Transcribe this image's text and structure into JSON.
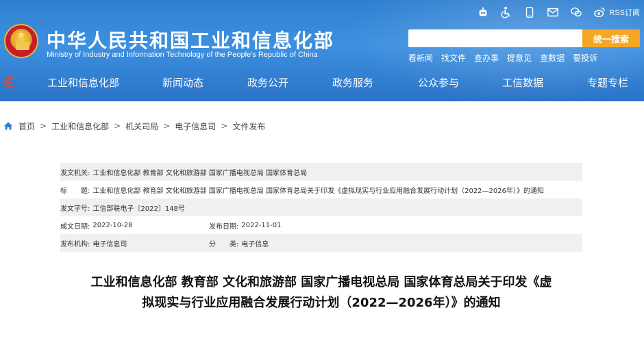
{
  "header": {
    "site_title_cn": "中华人民共和国工业和信息化部",
    "site_title_en": "Ministry of Industry and Information Technology of the People's Republic of China",
    "rss_label": "RSS订阅",
    "search": {
      "placeholder": "",
      "button_label": "统一搜索"
    },
    "quick_links": [
      "看新闻",
      "找文件",
      "查办事",
      "提意见",
      "查数据",
      "要投诉"
    ],
    "icons": [
      "robot-icon",
      "accessibility-icon",
      "mobile-icon",
      "mail-icon",
      "wechat-icon",
      "weibo-icon",
      "rss-icon"
    ]
  },
  "nav": {
    "items": [
      "工业和信息化部",
      "新闻动态",
      "政务公开",
      "政务服务",
      "公众参与",
      "工信数据",
      "专题专栏"
    ]
  },
  "breadcrumb": [
    "首页",
    "工业和信息化部",
    "机关司局",
    "电子信息司",
    "文件发布"
  ],
  "info": {
    "issuer_label": "发文机关:",
    "issuer_value": "工业和信息化部 教育部 文化和旅游部 国家广播电视总局 国家体育总局",
    "title_label": "标　　题:",
    "title_value": "工业和信息化部 教育部 文化和旅游部 国家广播电视总局 国家体育总局关于印发《虚拟现实与行业应用融合发展行动计划（2022—2026年）》的通知",
    "docno_label": "发文字号:",
    "docno_value": "工信部联电子〔2022〕148号",
    "created_label": "成文日期:",
    "created_value": "2022-10-28",
    "published_label": "发布日期:",
    "published_value": "2022-11-01",
    "office_label": "发布机构:",
    "office_value": "电子信息司",
    "category_label": "分　　类:",
    "category_value": "电子信息"
  },
  "article": {
    "title_line1": "工业和信息化部 教育部 文化和旅游部 国家广播电视总局 国家体育总局关于印发《虚",
    "title_line2": "拟现实与行业应用融合发展行动计划（2022—2026年）》的通知"
  },
  "colors": {
    "header_blue": "#2f7fd0",
    "search_orange": "#f5a623",
    "row_shade": "#f0f0f0"
  }
}
